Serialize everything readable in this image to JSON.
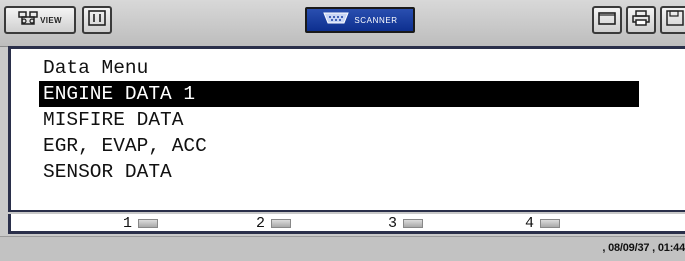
{
  "toolbar": {
    "view_label": "VIEW",
    "scanner_label": "SCANNER",
    "icons": [
      "view-icon",
      "split-screen-icon",
      "scanner-icon",
      "window-icon",
      "print-icon",
      "save-icon"
    ]
  },
  "screen": {
    "title": "Data Menu",
    "items": [
      {
        "label": "ENGINE DATA 1",
        "selected": true
      },
      {
        "label": "MISFIRE DATA",
        "selected": false
      },
      {
        "label": "EGR, EVAP, ACC",
        "selected": false
      },
      {
        "label": "SENSOR DATA",
        "selected": false
      }
    ]
  },
  "function_keys": [
    "1",
    "2",
    "3",
    "4"
  ],
  "status": {
    "datetime": ", 08/09/37 , 01:44"
  },
  "colors": {
    "selection_bg": "#000000",
    "scanner_button": "#1a3fa3",
    "screen_border": "#2a2f4a"
  }
}
